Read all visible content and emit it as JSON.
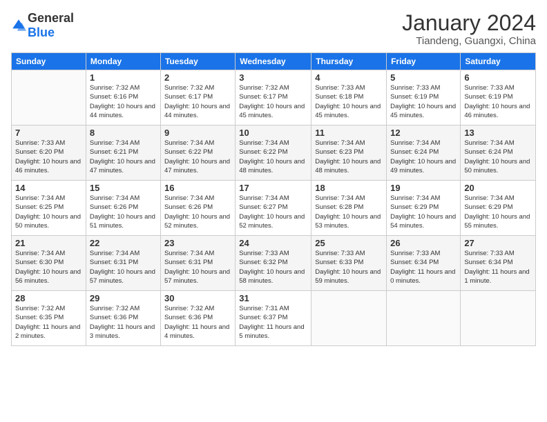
{
  "logo": {
    "general": "General",
    "blue": "Blue"
  },
  "title": "January 2024",
  "subtitle": "Tiandeng, Guangxi, China",
  "weekdays": [
    "Sunday",
    "Monday",
    "Tuesday",
    "Wednesday",
    "Thursday",
    "Friday",
    "Saturday"
  ],
  "weeks": [
    [
      {
        "day": "",
        "sunrise": "",
        "sunset": "",
        "daylight": ""
      },
      {
        "day": "1",
        "sunrise": "Sunrise: 7:32 AM",
        "sunset": "Sunset: 6:16 PM",
        "daylight": "Daylight: 10 hours and 44 minutes."
      },
      {
        "day": "2",
        "sunrise": "Sunrise: 7:32 AM",
        "sunset": "Sunset: 6:17 PM",
        "daylight": "Daylight: 10 hours and 44 minutes."
      },
      {
        "day": "3",
        "sunrise": "Sunrise: 7:32 AM",
        "sunset": "Sunset: 6:17 PM",
        "daylight": "Daylight: 10 hours and 45 minutes."
      },
      {
        "day": "4",
        "sunrise": "Sunrise: 7:33 AM",
        "sunset": "Sunset: 6:18 PM",
        "daylight": "Daylight: 10 hours and 45 minutes."
      },
      {
        "day": "5",
        "sunrise": "Sunrise: 7:33 AM",
        "sunset": "Sunset: 6:19 PM",
        "daylight": "Daylight: 10 hours and 45 minutes."
      },
      {
        "day": "6",
        "sunrise": "Sunrise: 7:33 AM",
        "sunset": "Sunset: 6:19 PM",
        "daylight": "Daylight: 10 hours and 46 minutes."
      }
    ],
    [
      {
        "day": "7",
        "sunrise": "Sunrise: 7:33 AM",
        "sunset": "Sunset: 6:20 PM",
        "daylight": "Daylight: 10 hours and 46 minutes."
      },
      {
        "day": "8",
        "sunrise": "Sunrise: 7:34 AM",
        "sunset": "Sunset: 6:21 PM",
        "daylight": "Daylight: 10 hours and 47 minutes."
      },
      {
        "day": "9",
        "sunrise": "Sunrise: 7:34 AM",
        "sunset": "Sunset: 6:22 PM",
        "daylight": "Daylight: 10 hours and 47 minutes."
      },
      {
        "day": "10",
        "sunrise": "Sunrise: 7:34 AM",
        "sunset": "Sunset: 6:22 PM",
        "daylight": "Daylight: 10 hours and 48 minutes."
      },
      {
        "day": "11",
        "sunrise": "Sunrise: 7:34 AM",
        "sunset": "Sunset: 6:23 PM",
        "daylight": "Daylight: 10 hours and 48 minutes."
      },
      {
        "day": "12",
        "sunrise": "Sunrise: 7:34 AM",
        "sunset": "Sunset: 6:24 PM",
        "daylight": "Daylight: 10 hours and 49 minutes."
      },
      {
        "day": "13",
        "sunrise": "Sunrise: 7:34 AM",
        "sunset": "Sunset: 6:24 PM",
        "daylight": "Daylight: 10 hours and 50 minutes."
      }
    ],
    [
      {
        "day": "14",
        "sunrise": "Sunrise: 7:34 AM",
        "sunset": "Sunset: 6:25 PM",
        "daylight": "Daylight: 10 hours and 50 minutes."
      },
      {
        "day": "15",
        "sunrise": "Sunrise: 7:34 AM",
        "sunset": "Sunset: 6:26 PM",
        "daylight": "Daylight: 10 hours and 51 minutes."
      },
      {
        "day": "16",
        "sunrise": "Sunrise: 7:34 AM",
        "sunset": "Sunset: 6:26 PM",
        "daylight": "Daylight: 10 hours and 52 minutes."
      },
      {
        "day": "17",
        "sunrise": "Sunrise: 7:34 AM",
        "sunset": "Sunset: 6:27 PM",
        "daylight": "Daylight: 10 hours and 52 minutes."
      },
      {
        "day": "18",
        "sunrise": "Sunrise: 7:34 AM",
        "sunset": "Sunset: 6:28 PM",
        "daylight": "Daylight: 10 hours and 53 minutes."
      },
      {
        "day": "19",
        "sunrise": "Sunrise: 7:34 AM",
        "sunset": "Sunset: 6:29 PM",
        "daylight": "Daylight: 10 hours and 54 minutes."
      },
      {
        "day": "20",
        "sunrise": "Sunrise: 7:34 AM",
        "sunset": "Sunset: 6:29 PM",
        "daylight": "Daylight: 10 hours and 55 minutes."
      }
    ],
    [
      {
        "day": "21",
        "sunrise": "Sunrise: 7:34 AM",
        "sunset": "Sunset: 6:30 PM",
        "daylight": "Daylight: 10 hours and 56 minutes."
      },
      {
        "day": "22",
        "sunrise": "Sunrise: 7:34 AM",
        "sunset": "Sunset: 6:31 PM",
        "daylight": "Daylight: 10 hours and 57 minutes."
      },
      {
        "day": "23",
        "sunrise": "Sunrise: 7:34 AM",
        "sunset": "Sunset: 6:31 PM",
        "daylight": "Daylight: 10 hours and 57 minutes."
      },
      {
        "day": "24",
        "sunrise": "Sunrise: 7:33 AM",
        "sunset": "Sunset: 6:32 PM",
        "daylight": "Daylight: 10 hours and 58 minutes."
      },
      {
        "day": "25",
        "sunrise": "Sunrise: 7:33 AM",
        "sunset": "Sunset: 6:33 PM",
        "daylight": "Daylight: 10 hours and 59 minutes."
      },
      {
        "day": "26",
        "sunrise": "Sunrise: 7:33 AM",
        "sunset": "Sunset: 6:34 PM",
        "daylight": "Daylight: 11 hours and 0 minutes."
      },
      {
        "day": "27",
        "sunrise": "Sunrise: 7:33 AM",
        "sunset": "Sunset: 6:34 PM",
        "daylight": "Daylight: 11 hours and 1 minute."
      }
    ],
    [
      {
        "day": "28",
        "sunrise": "Sunrise: 7:32 AM",
        "sunset": "Sunset: 6:35 PM",
        "daylight": "Daylight: 11 hours and 2 minutes."
      },
      {
        "day": "29",
        "sunrise": "Sunrise: 7:32 AM",
        "sunset": "Sunset: 6:36 PM",
        "daylight": "Daylight: 11 hours and 3 minutes."
      },
      {
        "day": "30",
        "sunrise": "Sunrise: 7:32 AM",
        "sunset": "Sunset: 6:36 PM",
        "daylight": "Daylight: 11 hours and 4 minutes."
      },
      {
        "day": "31",
        "sunrise": "Sunrise: 7:31 AM",
        "sunset": "Sunset: 6:37 PM",
        "daylight": "Daylight: 11 hours and 5 minutes."
      },
      {
        "day": "",
        "sunrise": "",
        "sunset": "",
        "daylight": ""
      },
      {
        "day": "",
        "sunrise": "",
        "sunset": "",
        "daylight": ""
      },
      {
        "day": "",
        "sunrise": "",
        "sunset": "",
        "daylight": ""
      }
    ]
  ]
}
